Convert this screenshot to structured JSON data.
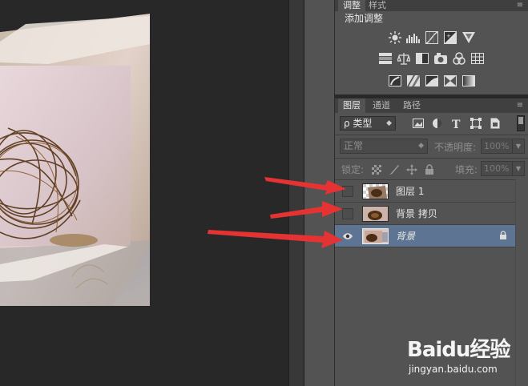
{
  "adjustments_panel": {
    "tabs": [
      "调整",
      "样式"
    ],
    "title": "添加调整",
    "rows": [
      [
        "brightness-contrast-icon",
        "levels-icon",
        "curves-icon",
        "exposure-icon",
        "vibrance-icon"
      ],
      [
        "hue-saturation-icon",
        "color-balance-icon",
        "black-white-icon",
        "photo-filter-icon",
        "channel-mixer-icon",
        "color-lookup-icon"
      ],
      [
        "invert-icon",
        "posterize-icon",
        "threshold-icon",
        "selective-color-icon",
        "gradient-map-icon"
      ]
    ]
  },
  "layers_panel": {
    "tabs": [
      "图层",
      "通道",
      "路径"
    ],
    "filter": {
      "label": "ρ 类型",
      "icons": [
        "pixel-filter-icon",
        "adjustment-filter-icon",
        "type-filter-icon",
        "shape-filter-icon",
        "smart-object-filter-icon"
      ]
    },
    "blend_mode": "正常",
    "opacity_label": "不透明度:",
    "opacity_value": "100%",
    "lock_label": "锁定:",
    "fill_label": "填充:",
    "fill_value": "100%",
    "layers": [
      {
        "name": "图层 1",
        "visible": false,
        "selected": false,
        "locked": false
      },
      {
        "name": "背景 拷贝",
        "visible": false,
        "selected": false,
        "locked": false
      },
      {
        "name": "背景",
        "visible": true,
        "selected": true,
        "locked": true
      }
    ]
  },
  "watermark": {
    "brand": "Baidu经验",
    "url": "jingyan.baidu.com"
  },
  "colors": {
    "accent_selected": "#5d7593",
    "arrow": "#e53333",
    "panel_bg": "#535353"
  }
}
